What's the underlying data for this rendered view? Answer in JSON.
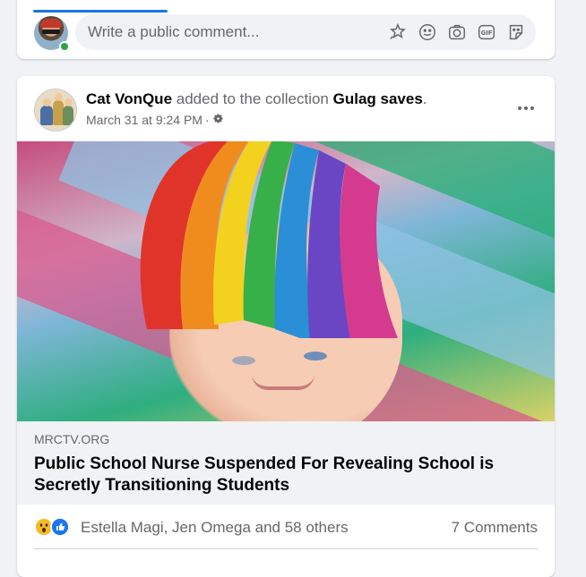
{
  "comment_composer": {
    "placeholder": "Write a public comment...",
    "icons": [
      "sticker-icon",
      "emoji-icon",
      "camera-icon",
      "gif-icon",
      "avatar-sticker-icon"
    ]
  },
  "post": {
    "author": "Cat VonQue",
    "action_text": " added to the collection ",
    "collection": "Gulag saves",
    "period": ".",
    "timestamp": "March 31 at 9:24 PM",
    "separator": "·",
    "privacy_icon": "gear-icon",
    "link": {
      "domain": "MRCTV.ORG",
      "title": "Public School Nurse Suspended For Revealing School is Secretly Transitioning Students"
    },
    "reactions": {
      "types": [
        "wow",
        "like"
      ],
      "summary": "Estella Magi, Jen Omega and 58 others",
      "comments": "7 Comments"
    }
  },
  "colors": {
    "accent": "#1b74e4",
    "online": "#31a24c",
    "secondary_text": "#65676b",
    "card_bg": "#ffffff",
    "page_bg": "#f0f2f5"
  }
}
